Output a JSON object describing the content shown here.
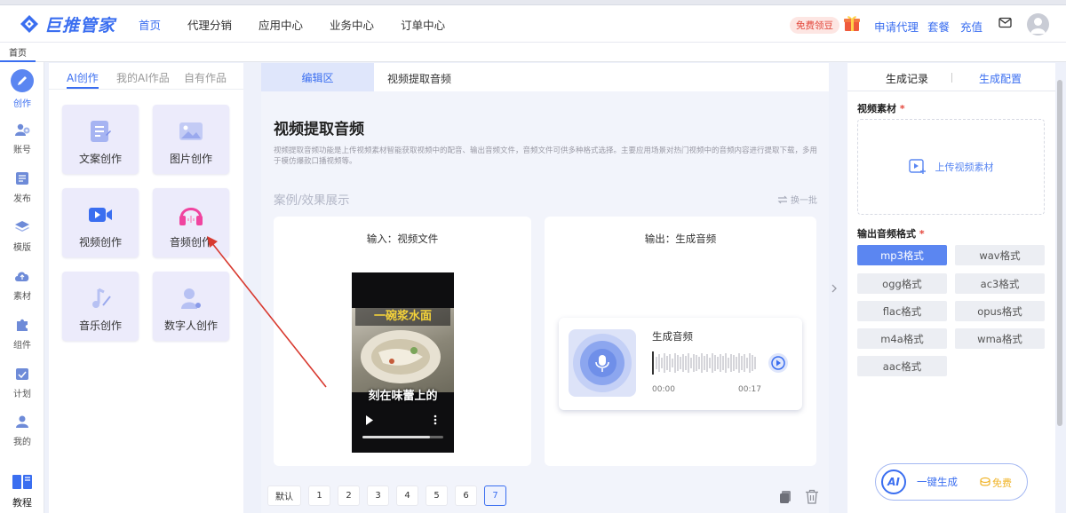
{
  "header": {
    "logo_text": "巨推管家",
    "nav": [
      "首页",
      "代理分销",
      "应用中心",
      "业务中心",
      "订单中心"
    ],
    "free_beans": "免费领豆",
    "apply_agent": "申请代理",
    "package": "套餐",
    "recharge": "充值"
  },
  "tabbar": {
    "home": "首页"
  },
  "sidebar": {
    "items": [
      "创作",
      "账号",
      "发布",
      "模版",
      "素材",
      "组件",
      "计划",
      "我的",
      "教程"
    ]
  },
  "left_panel": {
    "tabs": [
      "AI创作",
      "我的AI作品",
      "自有作品"
    ],
    "cards": [
      "文案创作",
      "图片创作",
      "视频创作",
      "音频创作",
      "音乐创作",
      "数字人创作"
    ]
  },
  "main": {
    "tabs": [
      "编辑区",
      "视频提取音频"
    ],
    "title": "视频提取音频",
    "description": "视频提取音频功能是上传视频素材智能获取视频中的配音、输出音频文件，音频文件可供多种格式选择。主要应用场景对热门视频中的音频内容进行提取下载，多用于模仿爆款口播视频等。",
    "showcase_label": "案例/效果展示",
    "switch_label": "换一批",
    "input_title": "输入：视频文件",
    "output_title": "输出：生成音频",
    "video_caption_1": "一碗浆水面",
    "video_caption_2": "刻在味蕾上的",
    "audio_title": "生成音频",
    "audio_start": "00:00",
    "audio_end": "00:17",
    "pager": [
      "默认",
      "1",
      "2",
      "3",
      "4",
      "5",
      "6",
      "7"
    ],
    "pager_active": "7"
  },
  "right_panel": {
    "tabs": [
      "生成记录",
      "生成配置"
    ],
    "video_material_label": "视频素材",
    "upload_label": "上传视频素材",
    "format_label": "输出音频格式",
    "formats": [
      "mp3格式",
      "wav格式",
      "ogg格式",
      "ac3格式",
      "flac格式",
      "opus格式",
      "m4a格式",
      "wma格式",
      "aac格式"
    ],
    "selected_format": "mp3格式",
    "generate_label": "一键生成",
    "generate_badge": "AI",
    "free_label": "免费"
  },
  "colors": {
    "accent": "#3a6ef0",
    "selected": "#5b86f1",
    "annotation_arrow": "#d83a30"
  }
}
